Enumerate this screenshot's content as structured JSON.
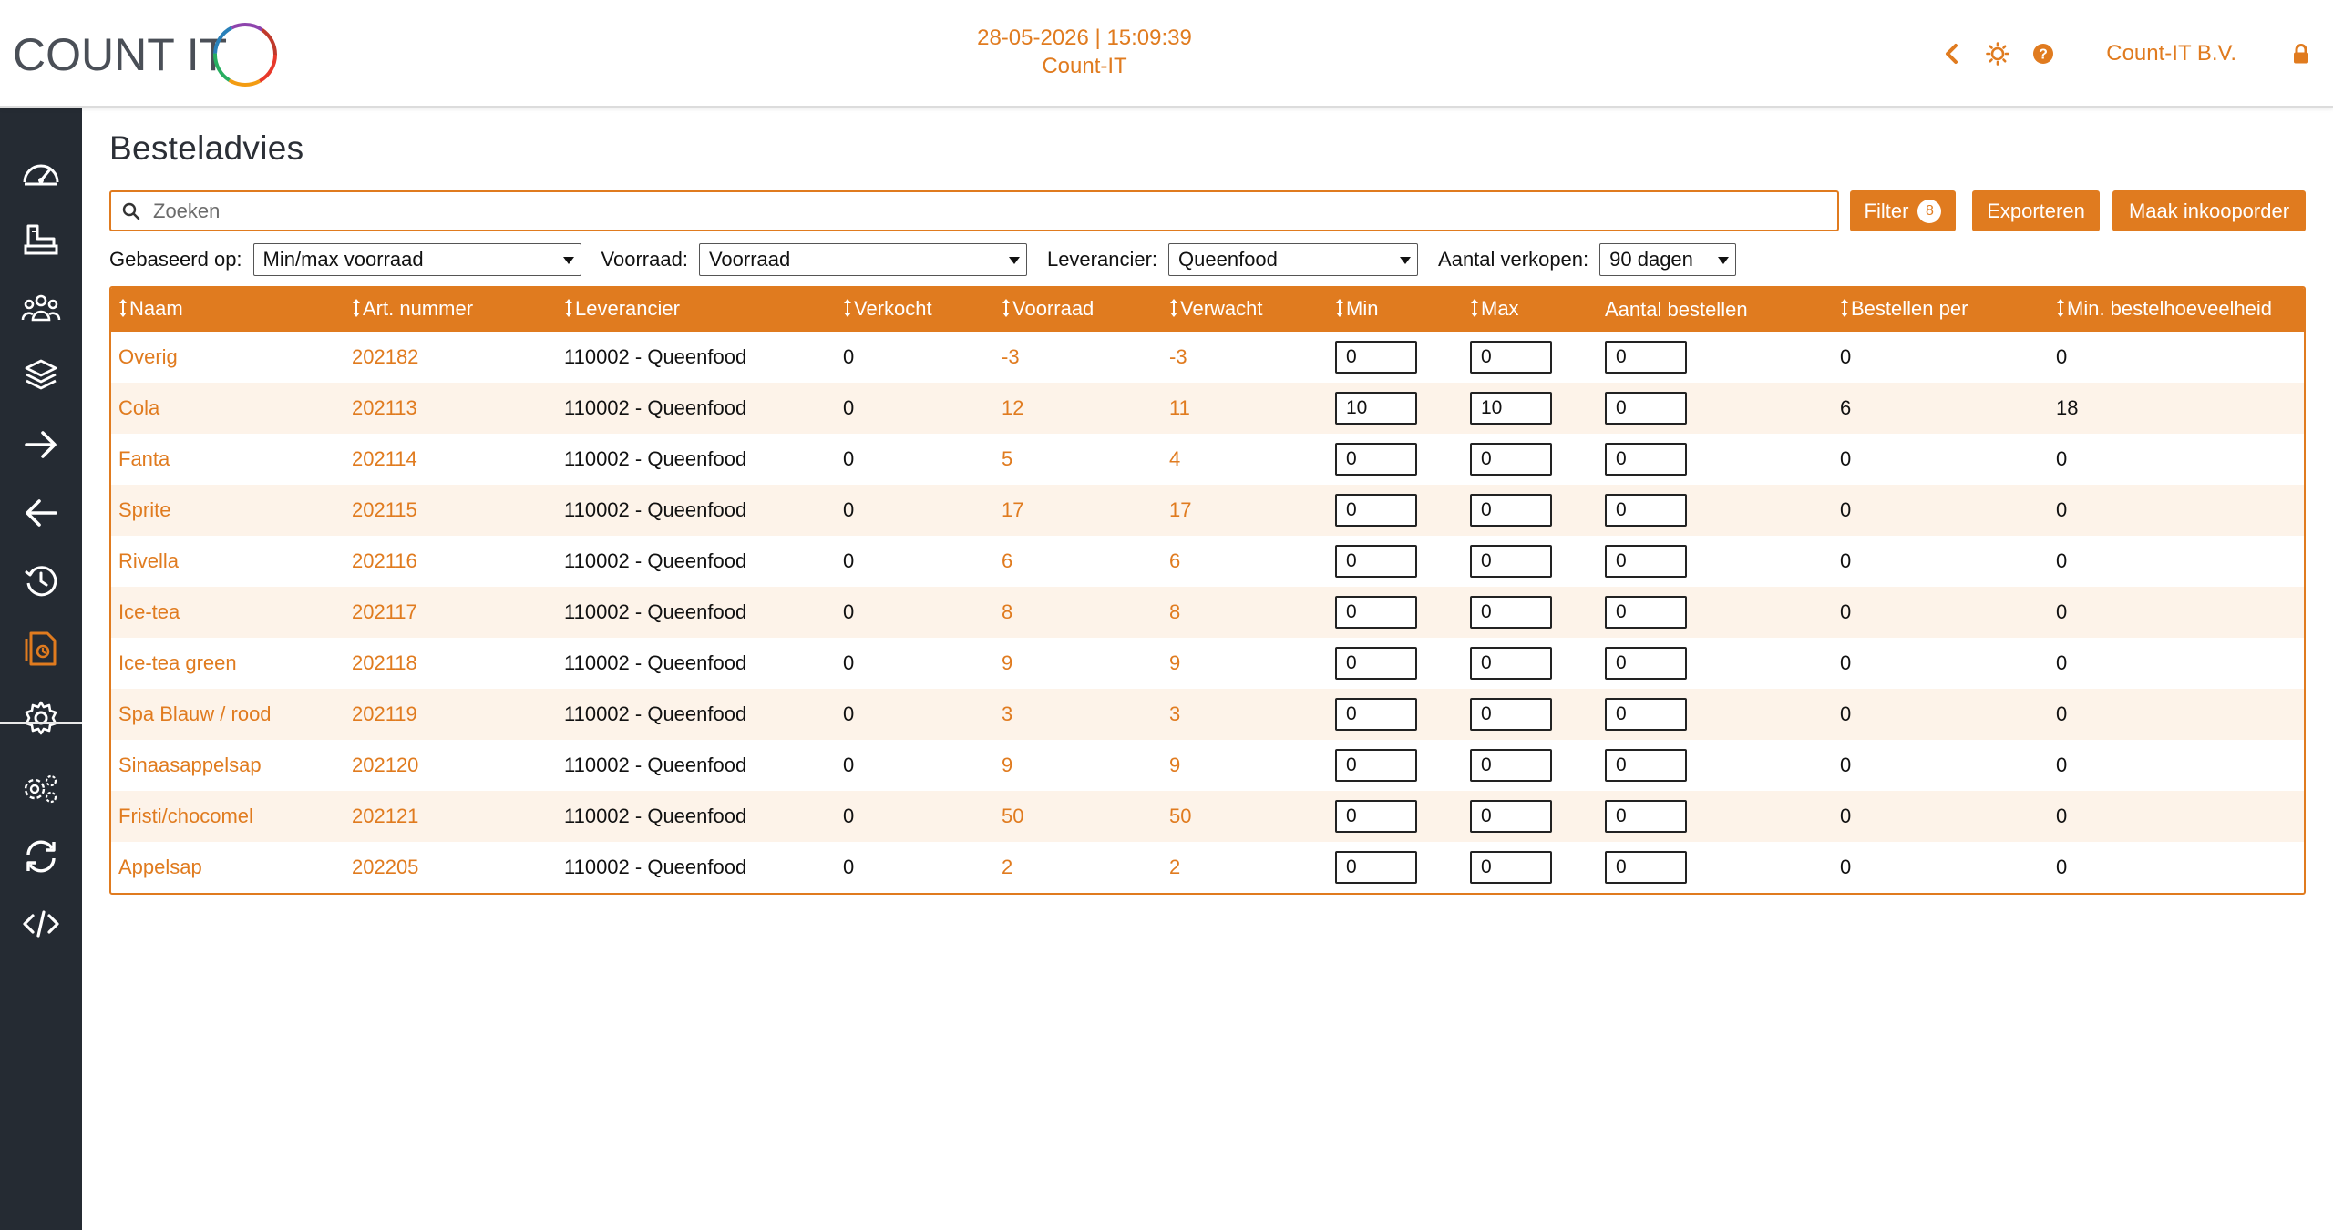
{
  "header": {
    "logo_text": "COUNT IT",
    "datetime": "28-05-2026 | 15:09:39",
    "app_name": "Count-IT",
    "company": "Count-IT B.V.",
    "icons": [
      "chevron-left-icon",
      "sun-icon",
      "help-icon",
      "lock-icon"
    ]
  },
  "sidebar": {
    "items": [
      {
        "icon": "dashboard-icon"
      },
      {
        "icon": "counter-icon"
      },
      {
        "icon": "users-icon"
      },
      {
        "icon": "layers-icon"
      },
      {
        "icon": "arrow-right-icon"
      },
      {
        "icon": "arrow-left-icon"
      },
      {
        "icon": "history-icon"
      },
      {
        "icon": "order-document-icon",
        "active": true
      },
      {
        "icon": "settings-icon"
      },
      {
        "icon": "advanced-settings-icon"
      },
      {
        "icon": "sync-icon"
      },
      {
        "icon": "code-icon"
      }
    ]
  },
  "page": {
    "title": "Besteladvies",
    "search_placeholder": "Zoeken",
    "filter_label": "Filter",
    "filter_count": "8",
    "export_label": "Exporteren",
    "create_order_label": "Maak inkooporder"
  },
  "filters": {
    "based_on_label": "Gebaseerd op:",
    "based_on_value": "Min/max voorraad",
    "stock_label": "Voorraad:",
    "stock_value": "Voorraad",
    "supplier_label": "Leverancier:",
    "supplier_value": "Queenfood",
    "sales_label": "Aantal verkopen:",
    "sales_value": "90 dagen"
  },
  "table": {
    "columns": [
      "Naam",
      "Art. nummer",
      "Leverancier",
      "Verkocht",
      "Voorraad",
      "Verwacht",
      "Min",
      "Max",
      "Aantal bestellen",
      "Bestellen per",
      "Min. bestelhoeveelheid"
    ],
    "rows": [
      {
        "naam": "Overig",
        "art": "202182",
        "lev": "110002 - Queenfood",
        "verkocht": "0",
        "voorraad": "-3",
        "verwacht": "-3",
        "min": "0",
        "max": "0",
        "aantal": "0",
        "per": "0",
        "minbest": "0"
      },
      {
        "naam": "Cola",
        "art": "202113",
        "lev": "110002 - Queenfood",
        "verkocht": "0",
        "voorraad": "12",
        "verwacht": "11",
        "min": "10",
        "max": "10",
        "aantal": "0",
        "per": "6",
        "minbest": "18"
      },
      {
        "naam": "Fanta",
        "art": "202114",
        "lev": "110002 - Queenfood",
        "verkocht": "0",
        "voorraad": "5",
        "verwacht": "4",
        "min": "0",
        "max": "0",
        "aantal": "0",
        "per": "0",
        "minbest": "0"
      },
      {
        "naam": "Sprite",
        "art": "202115",
        "lev": "110002 - Queenfood",
        "verkocht": "0",
        "voorraad": "17",
        "verwacht": "17",
        "min": "0",
        "max": "0",
        "aantal": "0",
        "per": "0",
        "minbest": "0"
      },
      {
        "naam": "Rivella",
        "art": "202116",
        "lev": "110002 - Queenfood",
        "verkocht": "0",
        "voorraad": "6",
        "verwacht": "6",
        "min": "0",
        "max": "0",
        "aantal": "0",
        "per": "0",
        "minbest": "0"
      },
      {
        "naam": "Ice-tea",
        "art": "202117",
        "lev": "110002 - Queenfood",
        "verkocht": "0",
        "voorraad": "8",
        "verwacht": "8",
        "min": "0",
        "max": "0",
        "aantal": "0",
        "per": "0",
        "minbest": "0"
      },
      {
        "naam": "Ice-tea green",
        "art": "202118",
        "lev": "110002 - Queenfood",
        "verkocht": "0",
        "voorraad": "9",
        "verwacht": "9",
        "min": "0",
        "max": "0",
        "aantal": "0",
        "per": "0",
        "minbest": "0"
      },
      {
        "naam": "Spa Blauw / rood",
        "art": "202119",
        "lev": "110002 - Queenfood",
        "verkocht": "0",
        "voorraad": "3",
        "verwacht": "3",
        "min": "0",
        "max": "0",
        "aantal": "0",
        "per": "0",
        "minbest": "0"
      },
      {
        "naam": "Sinaasappelsap",
        "art": "202120",
        "lev": "110002 - Queenfood",
        "verkocht": "0",
        "voorraad": "9",
        "verwacht": "9",
        "min": "0",
        "max": "0",
        "aantal": "0",
        "per": "0",
        "minbest": "0"
      },
      {
        "naam": "Fristi/chocomel",
        "art": "202121",
        "lev": "110002 - Queenfood",
        "verkocht": "0",
        "voorraad": "50",
        "verwacht": "50",
        "min": "0",
        "max": "0",
        "aantal": "0",
        "per": "0",
        "minbest": "0"
      },
      {
        "naam": "Appelsap",
        "art": "202205",
        "lev": "110002 - Queenfood",
        "verkocht": "0",
        "voorraad": "2",
        "verwacht": "2",
        "min": "0",
        "max": "0",
        "aantal": "0",
        "per": "0",
        "minbest": "0"
      }
    ]
  },
  "colors": {
    "accent": "#e07b1f",
    "sidebar": "#252b33",
    "row_alt": "#fdf3e9"
  }
}
